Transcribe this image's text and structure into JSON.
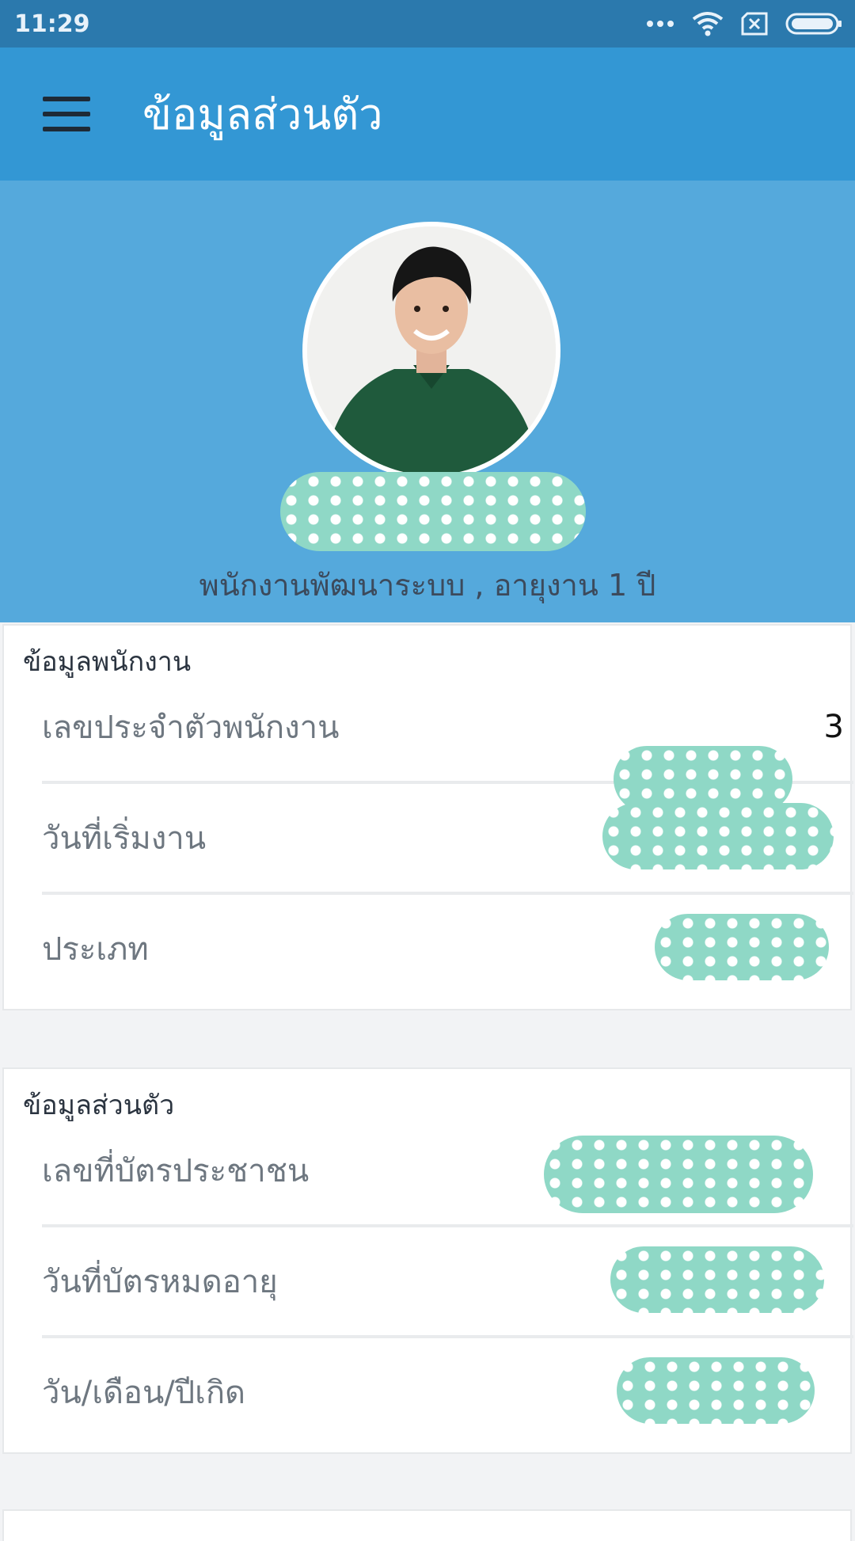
{
  "status_bar": {
    "time": "11:29",
    "more_icon": "more-dots-icon",
    "wifi_icon": "wifi-icon",
    "sim_icon": "sim-off-icon",
    "battery_icon": "battery-icon"
  },
  "app_bar": {
    "title": "ข้อมูลส่วนตัว",
    "menu_icon": "hamburger-menu-icon"
  },
  "profile": {
    "role_line": "พนักงานพัฒนาระบบ , อายุงาน 1 ปี"
  },
  "employee_card": {
    "title": "ข้อมูลพนักงาน",
    "rows": [
      {
        "label": "เลขประจำตัวพนักงาน",
        "value_suffix": "3"
      },
      {
        "label": "วันที่เริ่มงาน"
      },
      {
        "label": "ประเภท"
      }
    ]
  },
  "personal_card": {
    "title": "ข้อมูลส่วนตัว",
    "rows": [
      {
        "label": "เลขที่บัตรประชาชน"
      },
      {
        "label": "วันที่บัตรหมดอายุ"
      },
      {
        "label": "วัน/เดือน/ปีเกิด"
      }
    ]
  },
  "colors": {
    "status_bar": "#2b79ad",
    "app_bar": "#3397d4",
    "profile_header": "#55a9dc",
    "redaction": "#8fd8c6"
  }
}
